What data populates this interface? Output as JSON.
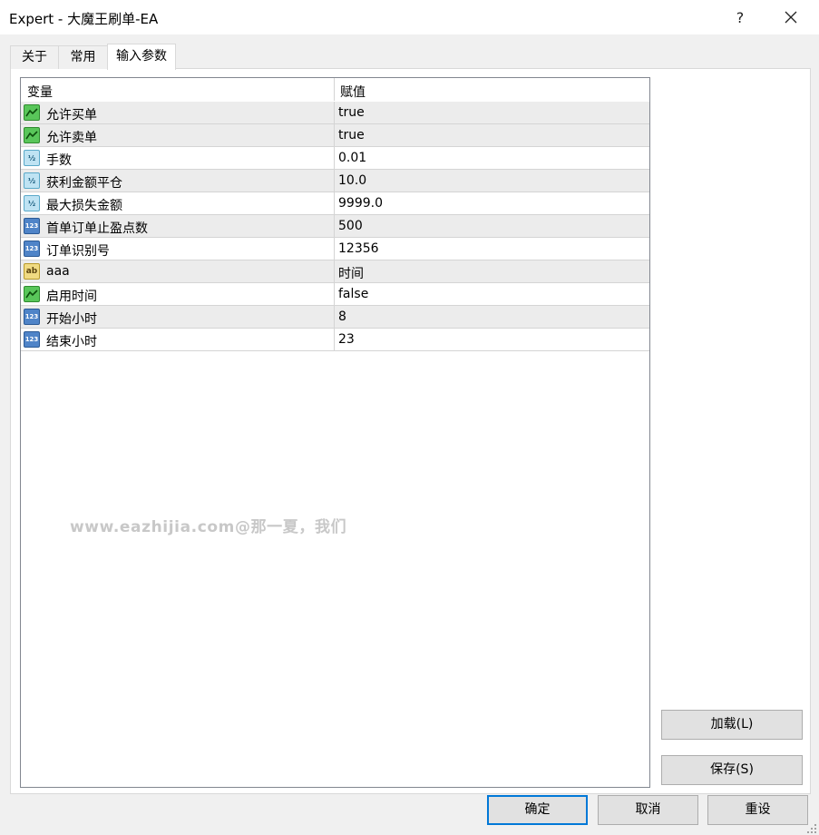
{
  "window": {
    "title": "Expert - 大魔王刷单-EA",
    "help_label": "?",
    "close_label": "✕"
  },
  "tabs": [
    {
      "label": "关于"
    },
    {
      "label": "常用"
    },
    {
      "label": "输入参数"
    }
  ],
  "grid": {
    "headers": {
      "variable": "变量",
      "value": "赋值"
    },
    "rows": [
      {
        "icon": "bool-icon",
        "name": "允许买单",
        "value": "true"
      },
      {
        "icon": "bool-icon",
        "name": "允许卖单",
        "value": "true"
      },
      {
        "icon": "double-icon",
        "name": "手数",
        "value": "0.01"
      },
      {
        "icon": "double-icon",
        "name": "获利金额平仓",
        "value": "10.0"
      },
      {
        "icon": "double-icon",
        "name": "最大损失金额",
        "value": "9999.0"
      },
      {
        "icon": "integer-icon",
        "name": "首单订单止盈点数",
        "value": "500"
      },
      {
        "icon": "integer-icon",
        "name": "订单识别号",
        "value": "12356"
      },
      {
        "icon": "string-icon",
        "name": "aaa",
        "value": "时间"
      },
      {
        "icon": "bool-icon",
        "name": "启用时间",
        "value": "false"
      },
      {
        "icon": "integer-icon",
        "name": "开始小时",
        "value": "8"
      },
      {
        "icon": "integer-icon",
        "name": "结束小时",
        "value": "23"
      }
    ]
  },
  "icon_glyphs": {
    "double": "½",
    "integer": "123",
    "string": "ab"
  },
  "watermark": "www.eazhijia.com@那一夏，我们",
  "buttons": {
    "load": "加载(L)",
    "save": "保存(S)",
    "ok": "确定",
    "cancel": "取消",
    "reset": "重设"
  },
  "colors": {
    "accent": "#0078d7",
    "alt_row": "#ececec",
    "bool_icon": "#59c65a",
    "int_icon": "#4f84c8",
    "double_icon": "#bfe3f3",
    "string_icon": "#f0da82"
  }
}
